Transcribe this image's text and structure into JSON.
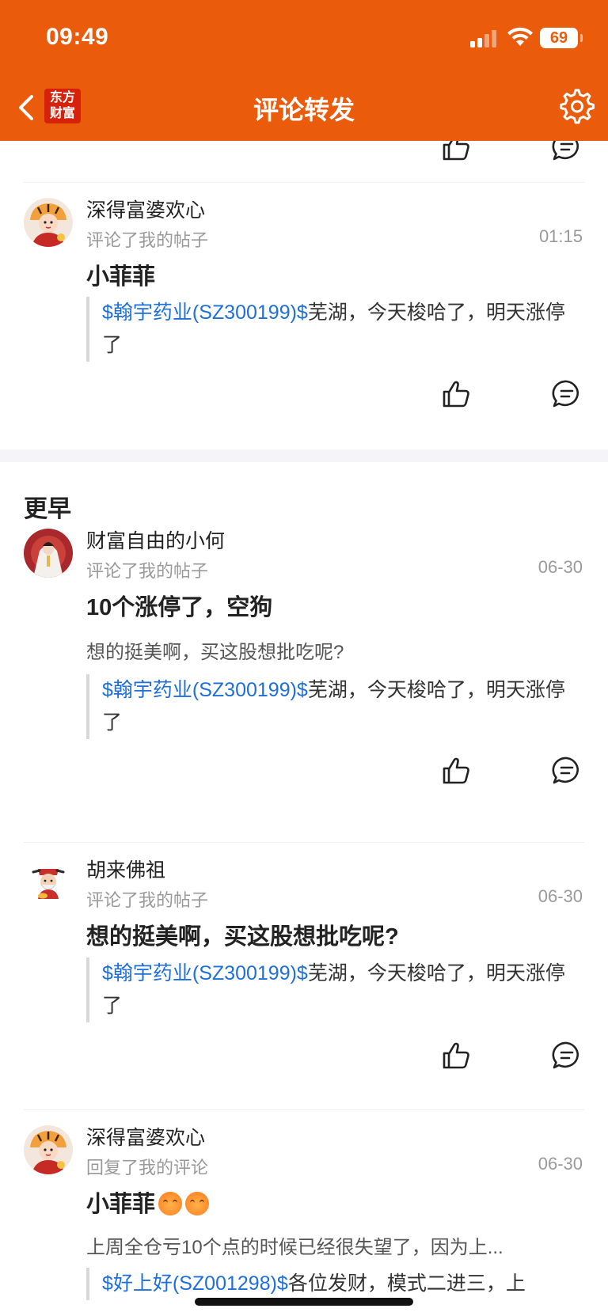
{
  "status_bar": {
    "time": "09:49",
    "battery": "69"
  },
  "nav": {
    "title": "评论转发",
    "logo_line1": "东方",
    "logo_line2": "财富"
  },
  "section_earlier": "更早",
  "items": [
    {
      "name": "深得富婆欢心",
      "action": "评论了我的帖子",
      "time": "01:15",
      "title": "小菲菲",
      "quote_stock": "$翰宇药业(SZ300199)$",
      "quote_text": "芜湖，今天梭哈了，明天涨停了"
    },
    {
      "name": "财富自由的小何",
      "action": "评论了我的帖子",
      "time": "06-30",
      "title": "10个涨停了，空狗",
      "reply": "想的挺美啊，买这股想批吃呢?",
      "quote_stock": "$翰宇药业(SZ300199)$",
      "quote_text": "芜湖，今天梭哈了，明天涨停了"
    },
    {
      "name": "胡来佛祖",
      "action": "评论了我的帖子",
      "time": "06-30",
      "title": "想的挺美啊，买这股想批吃呢?",
      "quote_stock": "$翰宇药业(SZ300199)$",
      "quote_text": "芜湖，今天梭哈了，明天涨停了"
    },
    {
      "name": "深得富婆欢心",
      "action": "回复了我的评论",
      "time": "06-30",
      "title": "小菲菲",
      "reply": "上周全仓亏10个点的时候已经很失望了，因为上...",
      "quote_stock": "$好上好(SZ001298)$",
      "quote_text": "各位发财，模式二进三，上"
    }
  ],
  "colors": {
    "brand": "#EA5B0C",
    "link": "#1E6FD9"
  }
}
